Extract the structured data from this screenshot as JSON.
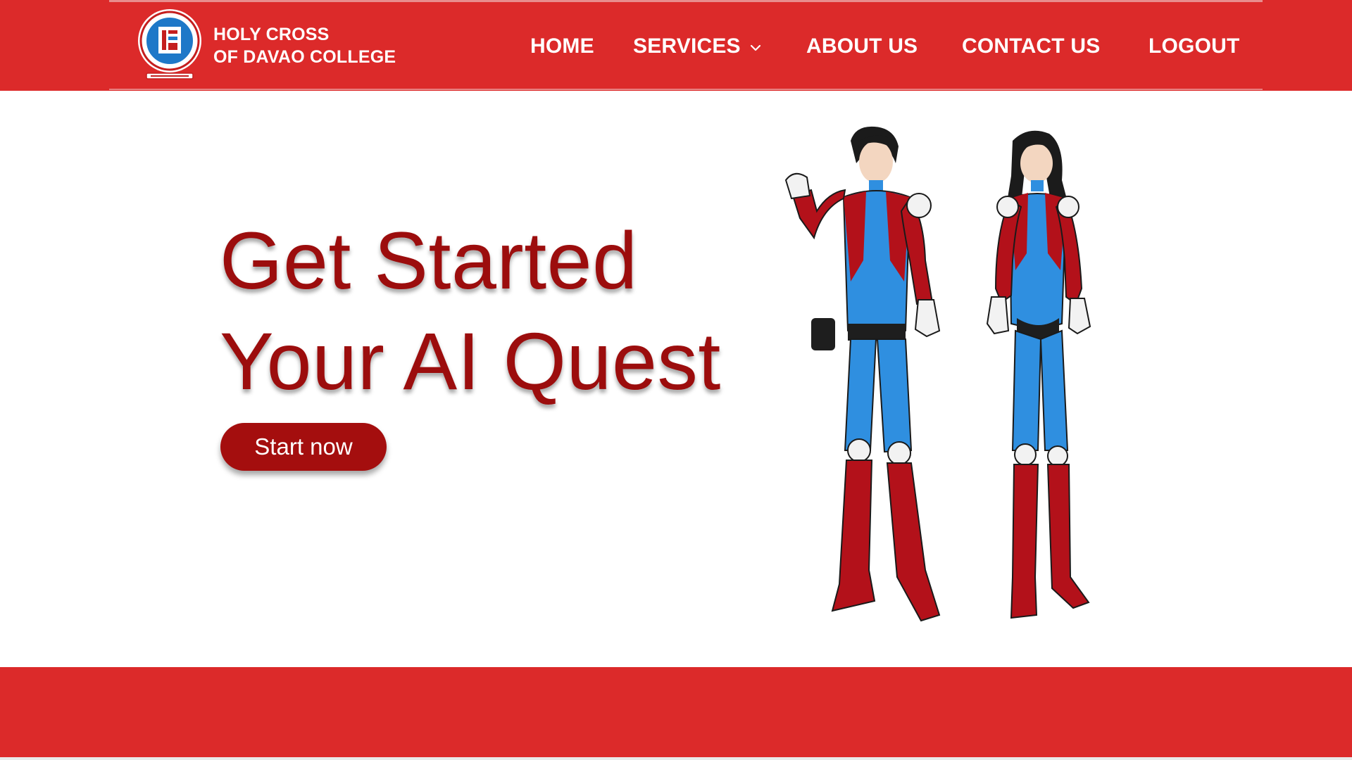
{
  "colors": {
    "brand_red": "#dc2a2a",
    "title_red": "#9c0d0d",
    "button_red": "#a40e0e",
    "suit_blue": "#2f8fe0",
    "suit_red": "#b3111a"
  },
  "header": {
    "logo_icon": "college-seal-icon",
    "brand_line1": "HOLY CROSS",
    "brand_line2": "OF DAVAO COLLEGE",
    "nav": {
      "home": "HOME",
      "services": "SERVICES",
      "services_icon": "chevron-down-icon",
      "about": "ABOUT US",
      "contact": "CONTACT US",
      "logout": "LOGOUT"
    }
  },
  "hero": {
    "title_line1": "Get Started",
    "title_line2": "Your AI Quest",
    "button_label": "Start now",
    "illustration_icon": "superhero-duo-illustration"
  }
}
